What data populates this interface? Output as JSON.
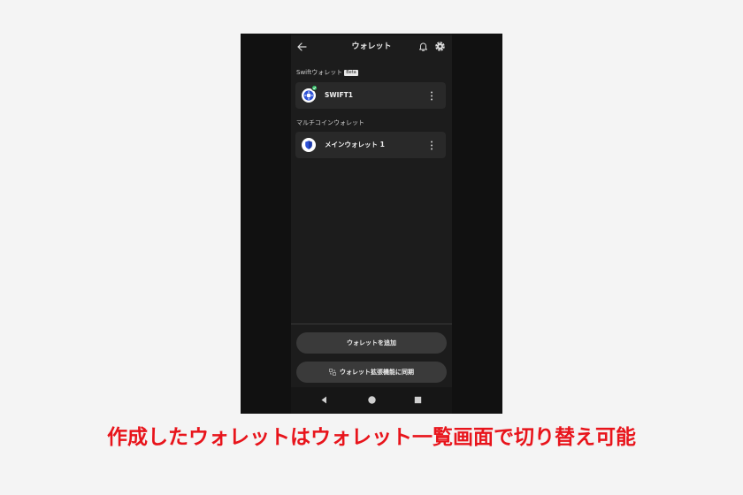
{
  "header": {
    "title": "ウォレット",
    "back_icon": "arrow-left-icon",
    "notification_icon": "bell-icon",
    "settings_icon": "gear-icon"
  },
  "sections": [
    {
      "label": "Swiftウォレット",
      "badge": "Beta",
      "wallets": [
        {
          "name": "SWIFT1",
          "icon": "swift-wallet-icon",
          "verified": true
        }
      ]
    },
    {
      "label": "マルチコインウォレット",
      "wallets": [
        {
          "name": "メインウォレット 1",
          "icon": "shield-wallet-icon",
          "verified": false
        }
      ]
    }
  ],
  "actions": {
    "add_wallet_label": "ウォレットを追加",
    "sync_extension_label": "ウォレット拡張機能に同期"
  },
  "colors": {
    "screen_bg": "#1c1c1c",
    "card_bg": "#292929",
    "button_bg": "#3a3a3a",
    "accent_blue": "#2e52d6",
    "verified_green": "#34c46a",
    "caption_red": "#e8141b"
  },
  "caption": "作成したウォレットはウォレット一覧画面で切り替え可能"
}
